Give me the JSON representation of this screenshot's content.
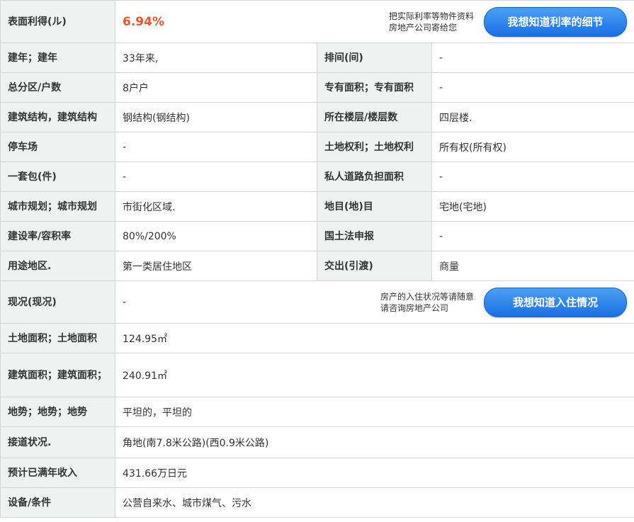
{
  "yield": {
    "label": "表面利得(ル)",
    "value": "6.94%",
    "note_line1": "把实际利率等物件资料",
    "note_line2": "房地产公司寄给您",
    "button": "我想知道利率的细节"
  },
  "rows": [
    {
      "l1": "建年；建年",
      "v1": "33年来,",
      "l2": "排间(间)",
      "v2": "-"
    },
    {
      "l1": "总分区/户数",
      "v1": "8户户",
      "l2": "专有面积；专有面积",
      "v2": "-"
    },
    {
      "l1": "建筑结构，建筑结构",
      "v1": "钢结构(钢结构)",
      "l2": "所在楼层/楼层数",
      "v2": "四层楼."
    },
    {
      "l1": "停车场",
      "v1": "-",
      "l2": "土地权利；土地权利",
      "v2": "所有权(所有权)"
    },
    {
      "l1": "一套包(件)",
      "v1": "-",
      "l2": "私人道路负担面积",
      "v2": "-"
    },
    {
      "l1": "城市规划；城市规划",
      "v1": "市街化区域.",
      "l2": "地目(地)目",
      "v2": "宅地(宅地)"
    },
    {
      "l1": "建设率/容积率",
      "v1": "80%/200%",
      "l2": "国土法申报",
      "v2": "-"
    },
    {
      "l1": "用途地区.",
      "v1": "第一类居住地区",
      "l2": "交出(引渡)",
      "v2": "商量"
    }
  ],
  "occupancy": {
    "label": "现况(现况)",
    "value": "-",
    "note_line1": "房产的入住状况等请随意",
    "note_line2": "请咨询房地产公司",
    "button": "我想知道入住情况"
  },
  "wide_rows": [
    {
      "label": "土地面积；土地面积",
      "value": "124.95㎡"
    },
    {
      "label": "建筑面积；建筑面积；",
      "value": "240.91㎡"
    },
    {
      "label": "地势；地势；地势",
      "value": "平坦的，平坦的"
    },
    {
      "label": "接道状况.",
      "value": "角地(南7.8米公路)(西0.9米公路)"
    },
    {
      "label": "预计已满年收入",
      "value": "431.66万日元"
    },
    {
      "label": "设备/条件",
      "value": "公营自来水、城市煤气、污水"
    }
  ]
}
